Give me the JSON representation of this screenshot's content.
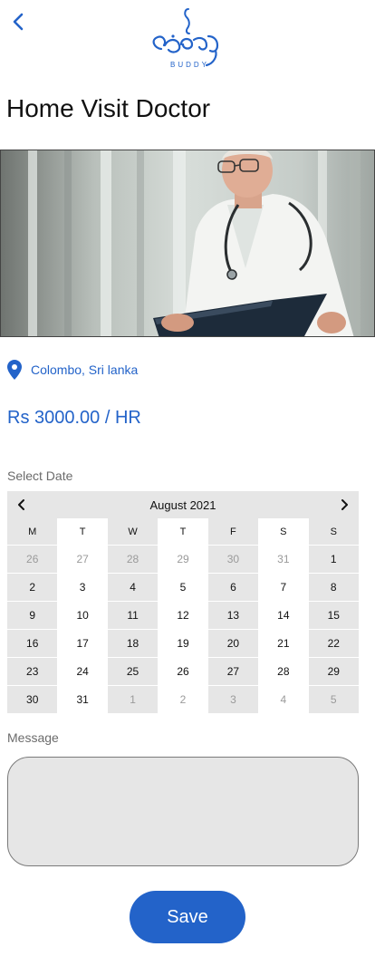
{
  "header": {
    "logo_text": "BUDDY"
  },
  "page": {
    "title": "Home Visit Doctor"
  },
  "location": {
    "text": "Colombo, Sri lanka"
  },
  "price": {
    "text": "Rs 3000.00 / HR"
  },
  "date_section": {
    "label": "Select Date",
    "month_label": "August 2021",
    "weekdays": [
      "M",
      "T",
      "W",
      "T",
      "F",
      "S",
      "S"
    ],
    "weeks": [
      [
        "26",
        "27",
        "28",
        "29",
        "30",
        "31",
        "1"
      ],
      [
        "2",
        "3",
        "4",
        "5",
        "6",
        "7",
        "8"
      ],
      [
        "9",
        "10",
        "11",
        "12",
        "13",
        "14",
        "15"
      ],
      [
        "16",
        "17",
        "18",
        "19",
        "20",
        "21",
        "22"
      ],
      [
        "23",
        "24",
        "25",
        "26",
        "27",
        "28",
        "29"
      ],
      [
        "30",
        "31",
        "1",
        "2",
        "3",
        "4",
        "5"
      ]
    ]
  },
  "message_section": {
    "label": "Message",
    "value": "",
    "placeholder": ""
  },
  "actions": {
    "save_label": "Save"
  },
  "colors": {
    "accent": "#2363c9",
    "calendar_shade": "#e6e6e6",
    "muted_text": "#9a9a9a"
  }
}
